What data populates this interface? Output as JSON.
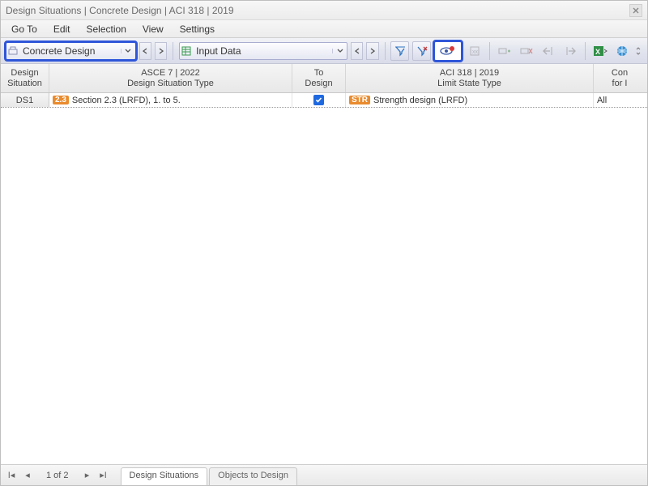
{
  "window": {
    "title": "Design Situations | Concrete Design | ACI 318 | 2019"
  },
  "menu": {
    "goto": "Go To",
    "edit": "Edit",
    "selection": "Selection",
    "view": "View",
    "settings": "Settings"
  },
  "toolbar": {
    "module_combo": "Concrete Design",
    "data_combo": "Input Data"
  },
  "columns": {
    "c1": {
      "l1": "Design",
      "l2": "Situation"
    },
    "c2": {
      "l1": "ASCE 7 | 2022",
      "l2": "Design Situation Type"
    },
    "c3": {
      "l1": "To",
      "l2": "Design"
    },
    "c4": {
      "l1": "ACI 318 | 2019",
      "l2": "Limit State Type"
    },
    "c5": {
      "l1": "Con",
      "l2": "for I"
    }
  },
  "rows": [
    {
      "id": "DS1",
      "type_badge": "2.3",
      "type_text": "Section 2.3 (LRFD), 1. to 5.",
      "to_design": true,
      "limit_badge": "STR",
      "limit_text": "Strength design (LRFD)",
      "extra": "All"
    }
  ],
  "footer": {
    "page": "1 of 2",
    "tab1": "Design Situations",
    "tab2": "Objects to Design"
  }
}
